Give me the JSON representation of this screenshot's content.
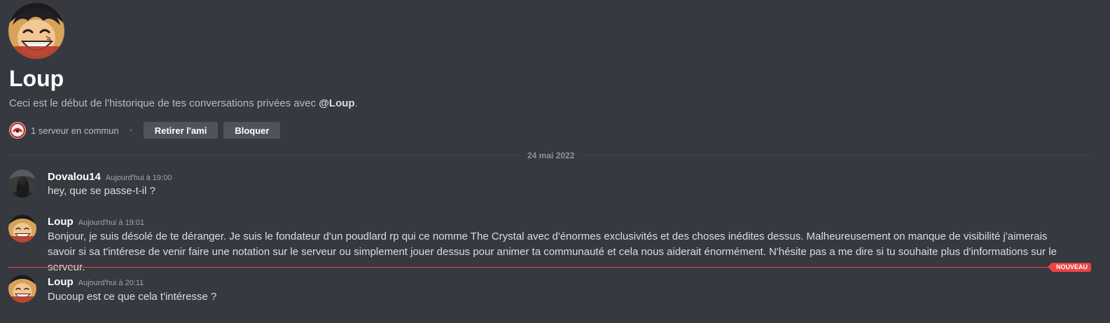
{
  "profile": {
    "name": "Loup",
    "intro_prefix": "Ceci est le début de l'historique de tes conversations privées avec ",
    "intro_mention": "@Loup",
    "intro_suffix": ".",
    "mutual_servers": "1 serveur en commun",
    "avatar_icon": "smiling-anime-character-avatar",
    "server_icon": "red-white-server-logo"
  },
  "actions": {
    "remove_friend_label": "Retirer l'ami",
    "block_label": "Bloquer"
  },
  "date_divider": "24 mai 2022",
  "new_divider": "NOUVEAU",
  "messages": [
    {
      "author": "Dovalou14",
      "time": "Aujourd'hui à 19:00",
      "content": "hey, que se passe-t-il ?",
      "avatar_icon": "dark-hooded-figure-avatar"
    },
    {
      "author": "Loup",
      "time": "Aujourd'hui à 19:01",
      "content": "Bonjour, je suis désolé de te déranger. Je suis le fondateur d'un poudlard rp qui ce nomme The Crystal avec d'énormes exclusivités et des choses inédites dessus. Malheureusement on manque de visibilité j'aimerais savoir si sa t'intérese de venir faire une notation sur le serveur ou simplement jouer dessus pour animer ta communauté et cela nous aiderait énormément. N'hésite pas a me dire si tu souhaite plus d'informations sur le serveur.",
      "avatar_icon": "smiling-anime-character-avatar"
    },
    {
      "author": "Loup",
      "time": "Aujourd'hui à 20:11",
      "content": "Ducoup est ce que cela t'intéresse ?",
      "avatar_icon": "smiling-anime-character-avatar"
    }
  ],
  "colors": {
    "background": "#36393f",
    "button": "#4f545c",
    "new_divider": "#ed4245"
  }
}
